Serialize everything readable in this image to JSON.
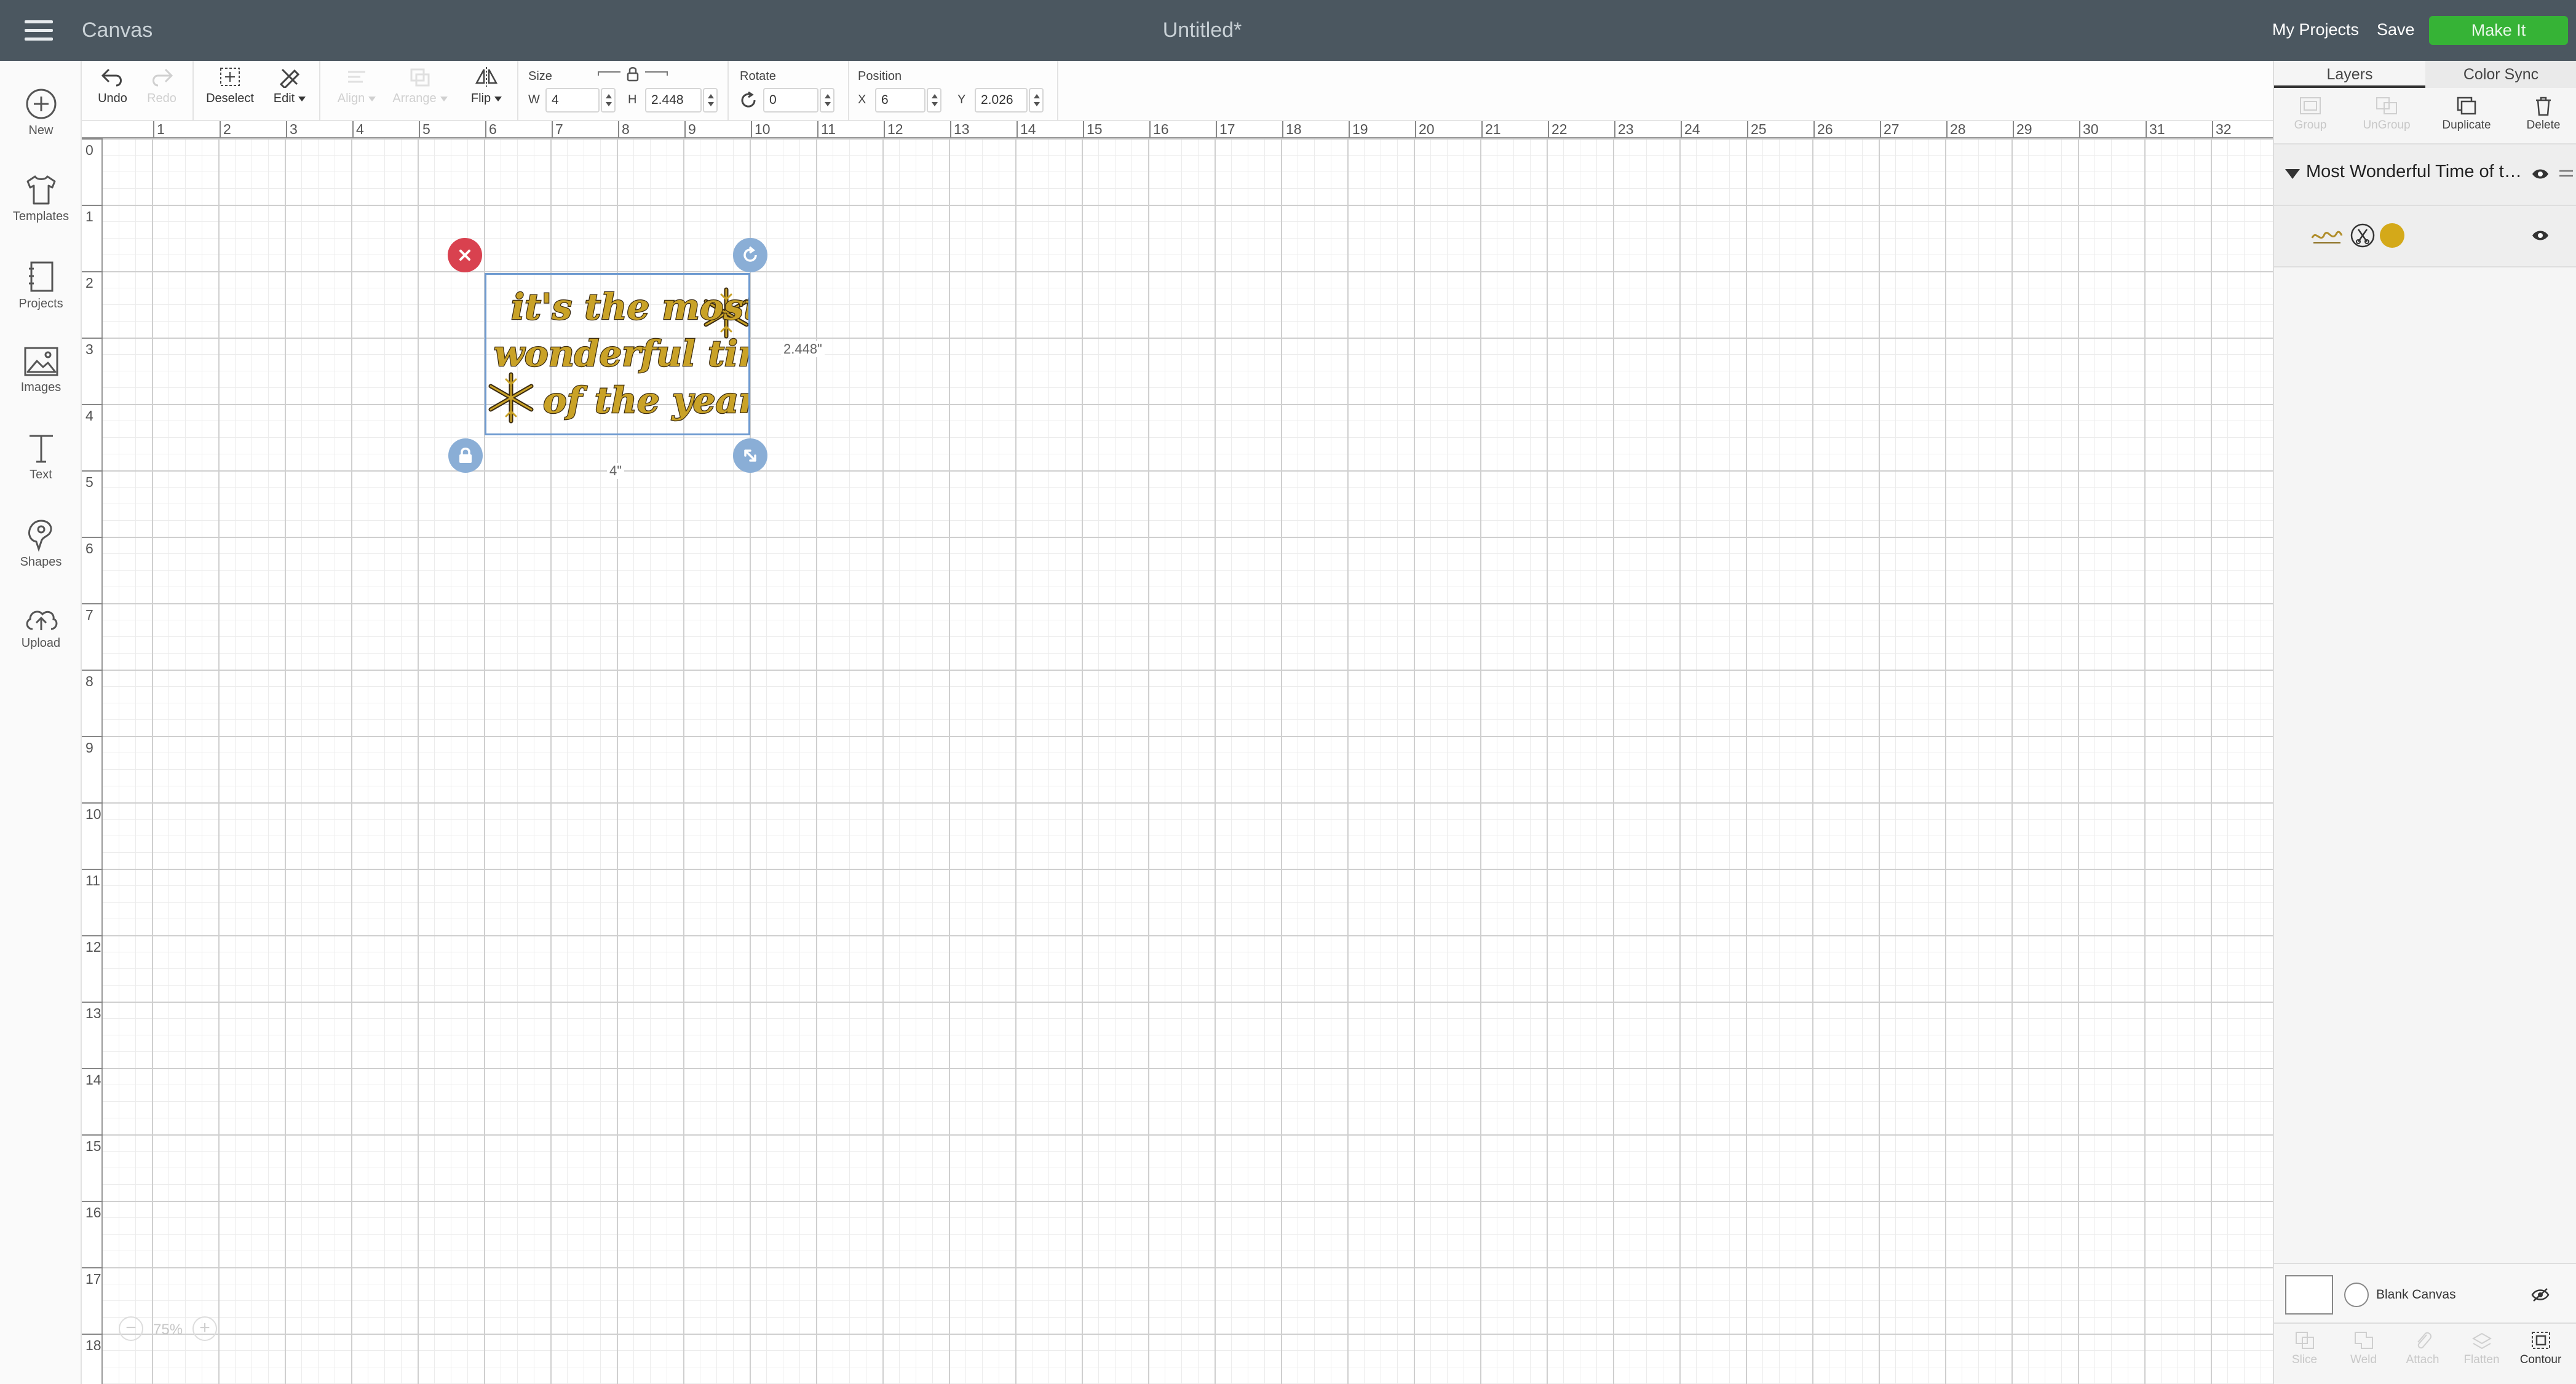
{
  "app": {
    "title": "Canvas",
    "doc_title": "Untitled*",
    "my_projects": "My Projects",
    "save": "Save",
    "make_it": "Make It"
  },
  "sidebar": {
    "items": [
      {
        "label": "New",
        "icon": "plus-circle-icon"
      },
      {
        "label": "Templates",
        "icon": "shirt-icon"
      },
      {
        "label": "Projects",
        "icon": "notebook-icon"
      },
      {
        "label": "Images",
        "icon": "image-icon"
      },
      {
        "label": "Text",
        "icon": "text-t-icon"
      },
      {
        "label": "Shapes",
        "icon": "shapes-icon"
      },
      {
        "label": "Upload",
        "icon": "cloud-upload-icon"
      }
    ]
  },
  "toolbar": {
    "undo": "Undo",
    "redo": "Redo",
    "deselect": "Deselect",
    "edit": "Edit",
    "align": "Align",
    "arrange": "Arrange",
    "flip": "Flip",
    "size_label": "Size",
    "w_label": "W",
    "w_value": "4",
    "h_label": "H",
    "h_value": "2.448",
    "rotate_label": "Rotate",
    "rotate_value": "0",
    "position_label": "Position",
    "x_label": "X",
    "x_value": "6",
    "y_label": "Y",
    "y_value": "2.026"
  },
  "canvas": {
    "ruler_h": [
      "1",
      "2",
      "3",
      "4",
      "5",
      "6",
      "7",
      "8",
      "9",
      "10",
      "11",
      "12",
      "13",
      "14",
      "15",
      "16",
      "17",
      "18",
      "19",
      "20",
      "21",
      "22",
      "23",
      "24",
      "25",
      "26",
      "27",
      "28",
      "29",
      "30",
      "31",
      "32"
    ],
    "ruler_v": [
      "0",
      "1",
      "2",
      "3",
      "4",
      "5",
      "6",
      "7",
      "8",
      "9",
      "10",
      "11",
      "12",
      "13",
      "14",
      "15",
      "16",
      "17",
      "18"
    ],
    "artwork_lines": [
      "it's the most",
      "wonderful time",
      "of the year"
    ],
    "height_label": "2.448\"",
    "width_label": "4\"",
    "zoom_value": "75%",
    "accent_gold": "#c9a227",
    "accent_brown": "#3a2a10"
  },
  "layers_panel": {
    "tab_layers": "Layers",
    "tab_color_sync": "Color Sync",
    "actions": {
      "group": "Group",
      "ungroup": "UnGroup",
      "duplicate": "Duplicate",
      "delete": "Delete"
    },
    "group_name": "Most Wonderful Time of the Year",
    "layer_color": "#d4a919",
    "blank_canvas": "Blank Canvas",
    "bottom_actions": {
      "slice": "Slice",
      "weld": "Weld",
      "attach": "Attach",
      "flatten": "Flatten",
      "contour": "Contour"
    }
  }
}
